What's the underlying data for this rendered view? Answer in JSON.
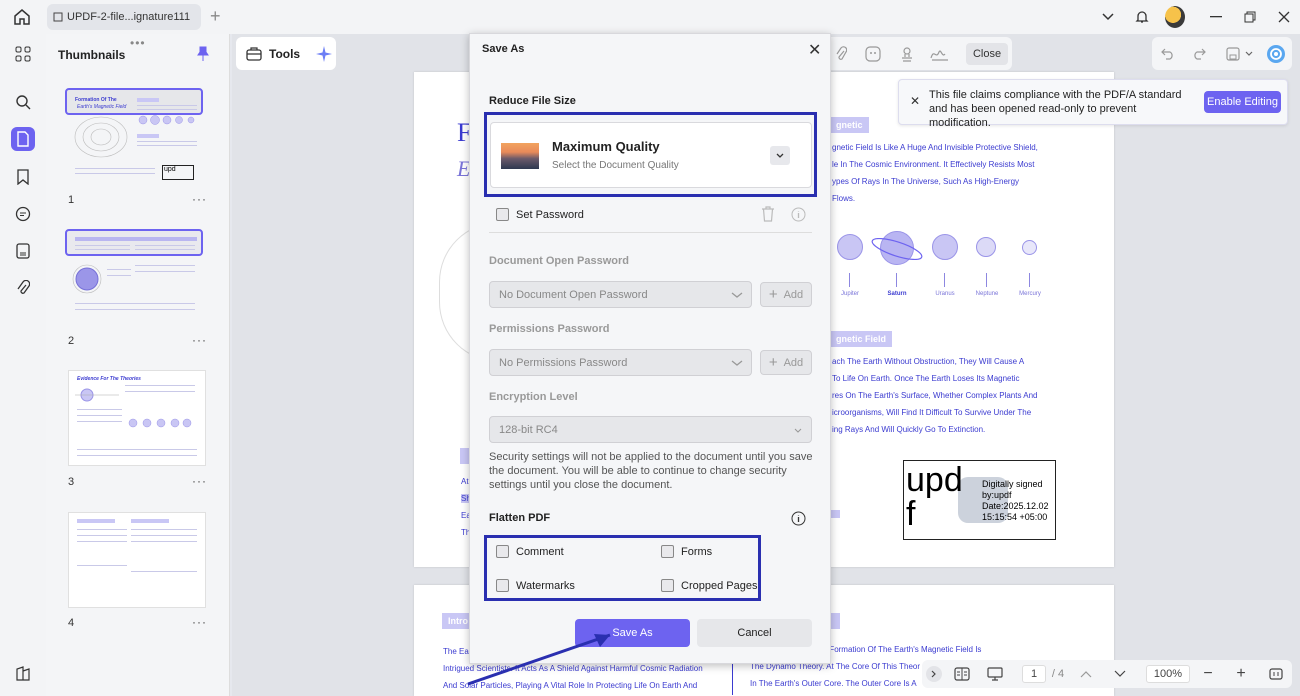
{
  "tab": {
    "title": "UPDF-2-file...ignature111"
  },
  "thumbnails": {
    "title": "Thumbnails",
    "pages": [
      {
        "num": "1",
        "dots": "···"
      },
      {
        "num": "2",
        "dots": "···"
      },
      {
        "num": "3",
        "dots": "···"
      },
      {
        "num": "4",
        "dots": "···"
      }
    ]
  },
  "toolbar": {
    "tools_label": "Tools",
    "close_label": "Close"
  },
  "banner": {
    "message": "This file claims compliance with the PDF/A standard and has been opened read-only to prevent modification.",
    "enable_label": "Enable Editing"
  },
  "document": {
    "thumb1_title": "Formation Of The",
    "thumb1_subtitle": "Earth's Magnetic Field",
    "thumb3_title": "Evidence For The Theories",
    "heading_magnetic": "gnetic",
    "lines_a": [
      "gnetic Field Is Like A Huge And Invisible Protective Shield,",
      "le In The Cosmic Environment. It Effectively Resists Most",
      "ypes Of Rays In The Universe, Such As High-Energy",
      "Flows."
    ],
    "planets": [
      "Jupiter",
      "Saturn",
      "Uranus",
      "Neptune",
      "Mercury"
    ],
    "heading_field": "gnetic Field",
    "lines_b": [
      "ach The Earth Without Obstruction, They Will Cause A",
      "To Life On Earth. Once The Earth Loses Its Magnetic",
      "res On The Earth's Surface, Whether Complex Plants And",
      "icroorganisms, Will Find It Difficult To Survive Under The",
      "ing Rays And Will Quickly Go To Extinction."
    ],
    "left_frag": [
      "F",
      "E"
    ],
    "left_mid": [
      "At",
      "Sh",
      "Ea",
      "Th"
    ],
    "signature": {
      "logo_text": "upd\nf",
      "lines": [
        "Digitally signed",
        "by:updf",
        "Date:2025.12.02",
        "15:15:54 +05:00"
      ]
    },
    "page2_heading_left": "Intro",
    "page2_left_lines": [
      "The Ea",
      "Intrigued Scientists. It Acts As A Shield Against Harmful Cosmic Radiation",
      "And Solar Particles, Playing A Vital Role In Protecting Life On Earth And"
    ],
    "page2_right_lines": [
      "epted Theory For The Formation Of The Earth's Magnetic Field Is",
      "The Dynamo Theory. At The Core Of This Theor",
      "In The Earth's Outer Core. The Outer Core Is A"
    ]
  },
  "pager": {
    "current": "1",
    "total": "/ 4",
    "zoom": "100%"
  },
  "dialog": {
    "title": "Save As",
    "reduce_label": "Reduce File Size",
    "quality_title": "Maximum Quality",
    "quality_sub": "Select the Document Quality",
    "set_password": "Set Password",
    "open_pw_label": "Document Open Password",
    "open_pw_value": "No Document Open Password",
    "perm_label": "Permissions Password",
    "perm_value": "No Permissions Password",
    "add_label": "Add",
    "enc_label": "Encryption Level",
    "enc_value": "128-bit RC4",
    "note": "Security settings will not be applied to the document until you save the document. You will be able to continue to change security settings until you close the document.",
    "flatten_label": "Flatten PDF",
    "flatten": {
      "comment": "Comment",
      "forms": "Forms",
      "watermarks": "Watermarks",
      "cropped": "Cropped Pages"
    },
    "save_label": "Save As",
    "cancel_label": "Cancel"
  },
  "colors": {
    "accent": "#6d63f0",
    "highlight": "#2a2fb0",
    "doc_text": "#3b3bd0"
  }
}
